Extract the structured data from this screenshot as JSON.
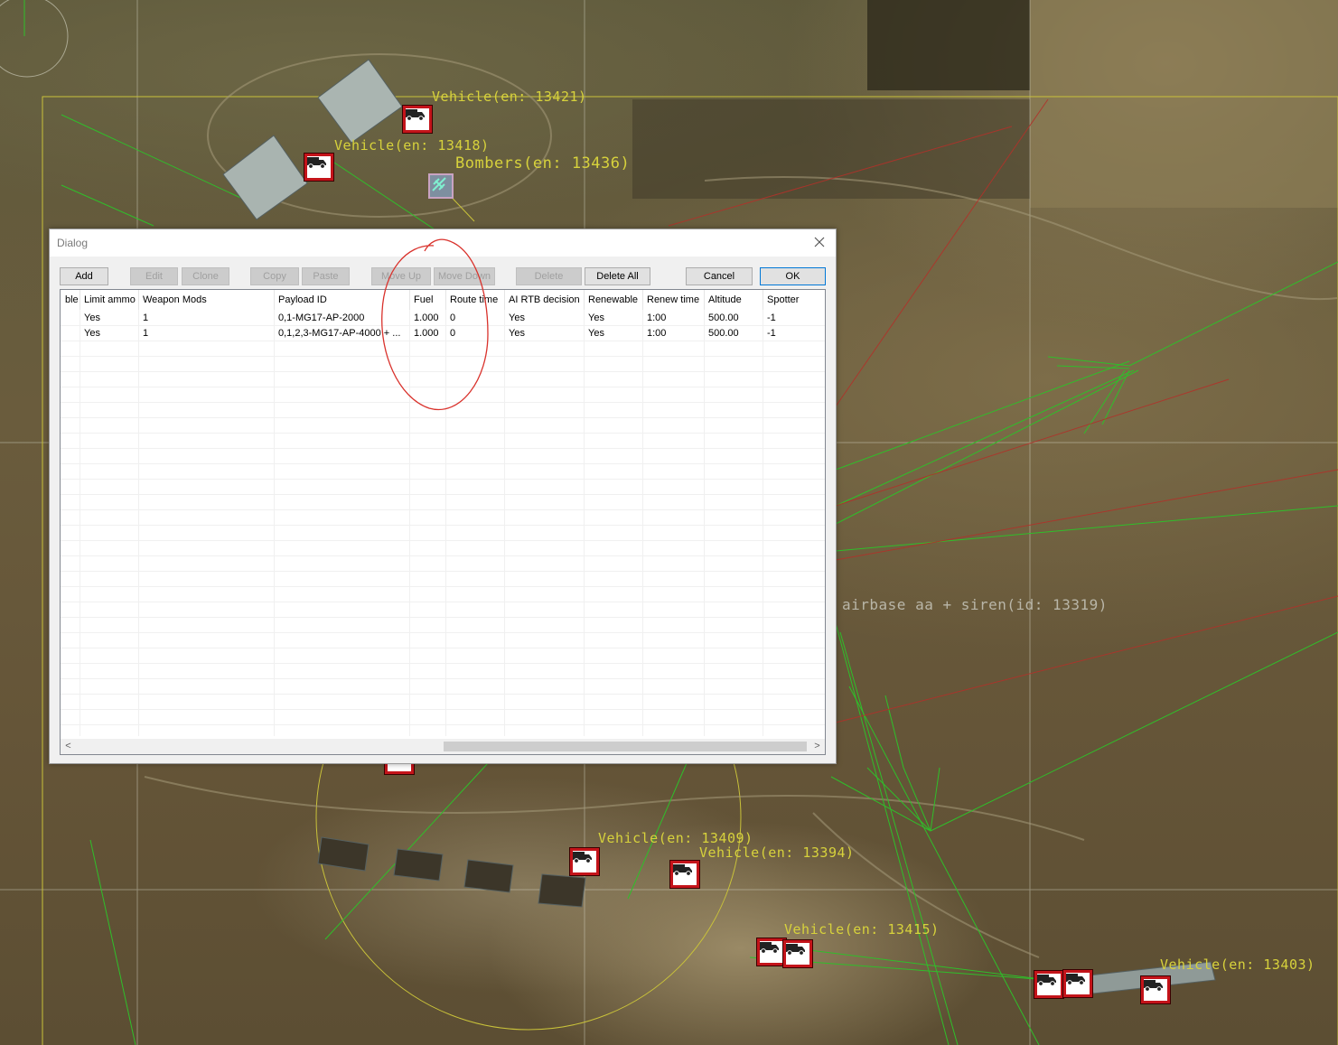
{
  "map": {
    "labels": {
      "vehicle_13421": "Vehicle(en: 13421)",
      "vehicle_13418": "Vehicle(en: 13418)",
      "bombers": "Bombers(en: 13436)",
      "airbase": "airbase aa + siren(id: 13319)",
      "vehicle_13409": "Vehicle(en: 13409)",
      "vehicle_13394": "Vehicle(en: 13394)",
      "vehicle_overlap_a": "Vehicle(en: 13415)",
      "vehicle_overlap_b": "Vehicle(en: 13403)"
    },
    "colors": {
      "label": "#d7d23c",
      "unit_border": "#c4141a",
      "green_line": "#2fbf2a",
      "red_line": "#b0322a",
      "annotation": "#d9322c"
    }
  },
  "dialog": {
    "title": "Dialog",
    "close_icon": "close-icon",
    "toolbar": {
      "add": "Add",
      "edit": "Edit",
      "clone": "Clone",
      "copy": "Copy",
      "paste": "Paste",
      "move_up": "Move Up",
      "move_down": "Move Down",
      "delete": "Delete",
      "delete_all": "Delete All",
      "cancel": "Cancel",
      "ok": "OK"
    },
    "table": {
      "columns": [
        "ble",
        "Limit ammo",
        "Weapon Mods",
        "Payload ID",
        "Fuel",
        "Route time",
        "AI RTB decision",
        "Renewable",
        "Renew time",
        "Altitude",
        "Spotter"
      ],
      "rows": [
        [
          "",
          "Yes",
          "1",
          "0,1-MG17-AP-2000",
          "1.000",
          "0",
          "Yes",
          "Yes",
          "1:00",
          "500.00",
          "-1"
        ],
        [
          "",
          "Yes",
          "1",
          "0,1,2,3-MG17-AP-4000 + ...",
          "1.000",
          "0",
          "Yes",
          "Yes",
          "1:00",
          "500.00",
          "-1"
        ]
      ]
    },
    "scrollbar": {
      "left_arrow": "<",
      "right_arrow": ">"
    }
  }
}
